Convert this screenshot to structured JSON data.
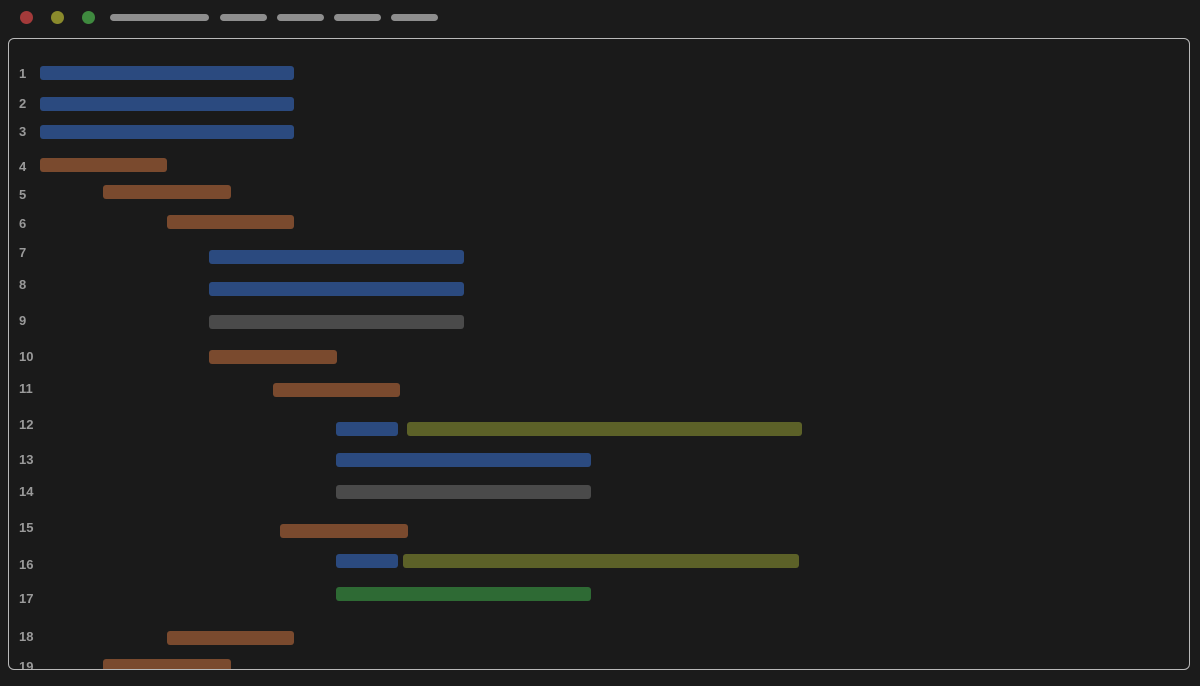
{
  "window": {
    "buttons": [
      {
        "name": "close",
        "color": "#a33a3a"
      },
      {
        "name": "minimize",
        "color": "#8a8a2c"
      },
      {
        "name": "maximize",
        "color": "#3f8a3f"
      }
    ],
    "tabs": [
      {
        "name": "tab-1",
        "level": 1
      },
      {
        "name": "tab-2",
        "level": 1
      },
      {
        "name": "tab-3",
        "level": 1
      },
      {
        "name": "tab-4",
        "level": 1
      },
      {
        "name": "tab-5",
        "level": 1
      }
    ],
    "tab_color": "#8e8e8e"
  },
  "colors": {
    "blue": "#2b4a7f",
    "orange": "#7a4a2e",
    "gray": "#4a4a4a",
    "olive": "#5c6128",
    "green": "#2e6a34"
  },
  "lines": [
    {
      "number": "1"
    },
    {
      "number": "2"
    },
    {
      "number": "3"
    },
    {
      "number": "4"
    },
    {
      "number": "5"
    },
    {
      "number": "6"
    },
    {
      "number": "7"
    },
    {
      "number": "8"
    },
    {
      "number": "9"
    },
    {
      "number": "10"
    },
    {
      "number": "11"
    },
    {
      "number": "12"
    },
    {
      "number": "13"
    },
    {
      "number": "14"
    },
    {
      "number": "15"
    },
    {
      "number": "16"
    },
    {
      "number": "17"
    },
    {
      "number": "18"
    },
    {
      "number": "19"
    }
  ]
}
